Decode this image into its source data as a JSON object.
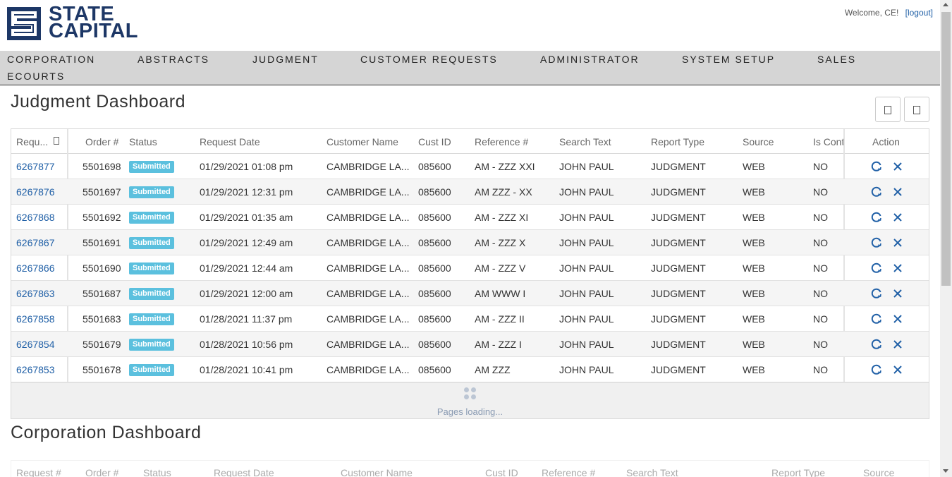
{
  "logo": {
    "line1": "STATE",
    "line2": "CAPITAL"
  },
  "header": {
    "welcome": "Welcome, CE!",
    "logout": "[logout]"
  },
  "nav": [
    "CORPORATION",
    "ABSTRACTS",
    "JUDGMENT",
    "CUSTOMER REQUESTS",
    "ADMINISTRATOR",
    "SYSTEM SETUP",
    "SALES",
    "ECOURTS"
  ],
  "judgment": {
    "title": "Judgment Dashboard",
    "columns": [
      "Requ...",
      "Order #",
      "Status",
      "Request Date",
      "Customer Name",
      "Cust ID",
      "Reference #",
      "Search Text",
      "Report Type",
      "Source",
      "Is Cont",
      "Action"
    ],
    "rows": [
      {
        "req": "6267877",
        "order": "5501698",
        "status": "Submitted",
        "date": "01/29/2021 01:08 pm",
        "customer": "CAMBRIDGE LA...",
        "cust_id": "085600",
        "ref": "AM - ZZZ XXI",
        "search": "JOHN PAUL",
        "report": "JUDGMENT",
        "source": "WEB",
        "cont": "NO"
      },
      {
        "req": "6267876",
        "order": "5501697",
        "status": "Submitted",
        "date": "01/29/2021 12:31 pm",
        "customer": "CAMBRIDGE LA...",
        "cust_id": "085600",
        "ref": "AM ZZZ - XX",
        "search": "JOHN PAUL",
        "report": "JUDGMENT",
        "source": "WEB",
        "cont": "NO"
      },
      {
        "req": "6267868",
        "order": "5501692",
        "status": "Submitted",
        "date": "01/29/2021 01:35 am",
        "customer": "CAMBRIDGE LA...",
        "cust_id": "085600",
        "ref": "AM - ZZZ XI",
        "search": "JOHN PAUL",
        "report": "JUDGMENT",
        "source": "WEB",
        "cont": "NO"
      },
      {
        "req": "6267867",
        "order": "5501691",
        "status": "Submitted",
        "date": "01/29/2021 12:49 am",
        "customer": "CAMBRIDGE LA...",
        "cust_id": "085600",
        "ref": "AM - ZZZ X",
        "search": "JOHN PAUL",
        "report": "JUDGMENT",
        "source": "WEB",
        "cont": "NO"
      },
      {
        "req": "6267866",
        "order": "5501690",
        "status": "Submitted",
        "date": "01/29/2021 12:44 am",
        "customer": "CAMBRIDGE LA...",
        "cust_id": "085600",
        "ref": "AM - ZZZ V",
        "search": "JOHN PAUL",
        "report": "JUDGMENT",
        "source": "WEB",
        "cont": "NO"
      },
      {
        "req": "6267863",
        "order": "5501687",
        "status": "Submitted",
        "date": "01/29/2021 12:00 am",
        "customer": "CAMBRIDGE LA...",
        "cust_id": "085600",
        "ref": "AM WWW I",
        "search": "JOHN PAUL",
        "report": "JUDGMENT",
        "source": "WEB",
        "cont": "NO"
      },
      {
        "req": "6267858",
        "order": "5501683",
        "status": "Submitted",
        "date": "01/28/2021 11:37 pm",
        "customer": "CAMBRIDGE LA...",
        "cust_id": "085600",
        "ref": "AM - ZZZ II",
        "search": "JOHN PAUL",
        "report": "JUDGMENT",
        "source": "WEB",
        "cont": "NO"
      },
      {
        "req": "6267854",
        "order": "5501679",
        "status": "Submitted",
        "date": "01/28/2021 10:56 pm",
        "customer": "CAMBRIDGE LA...",
        "cust_id": "085600",
        "ref": "AM - ZZZ I",
        "search": "JOHN PAUL",
        "report": "JUDGMENT",
        "source": "WEB",
        "cont": "NO"
      },
      {
        "req": "6267853",
        "order": "5501678",
        "status": "Submitted",
        "date": "01/28/2021 10:41 pm",
        "customer": "CAMBRIDGE LA...",
        "cust_id": "085600",
        "ref": "AM ZZZ",
        "search": "JOHN PAUL",
        "report": "JUDGMENT",
        "source": "WEB",
        "cont": "NO"
      }
    ],
    "loading": "Pages loading..."
  },
  "corporation": {
    "title": "Corporation Dashboard",
    "columns": [
      "Request #",
      "Order #",
      "Status",
      "Request Date",
      "Customer Name",
      "Cust ID",
      "Reference #",
      "Search Text",
      "Report Type",
      "Source"
    ]
  },
  "icons": {
    "refresh": "refresh-icon",
    "cancel": "close-icon",
    "menu": "column-menu-icon"
  },
  "colors": {
    "brand": "#1d3766",
    "link": "#1f5fa6",
    "badge": "#5bc0de",
    "nav_bg": "#d5d5d5"
  }
}
